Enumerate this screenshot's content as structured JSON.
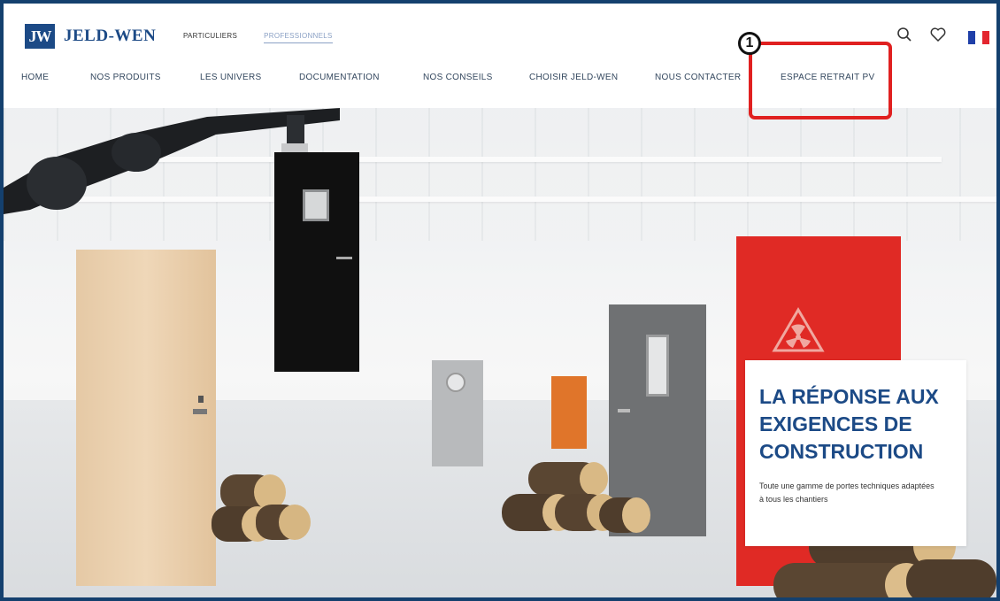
{
  "brand": {
    "logo_mark": "JW",
    "name": "JELD-WEN"
  },
  "audience": {
    "items": [
      "PARTICULIERS",
      "PROFESSIONNELS"
    ],
    "active": "PROFESSIONNELS"
  },
  "nav": {
    "items": [
      "HOME",
      "NOS PRODUITS",
      "LES UNIVERS",
      "DOCUMENTATION",
      "NOS CONSEILS",
      "CHOISIR JELD-WEN",
      "NOUS CONTACTER",
      "ESPACE RETRAIT PV"
    ]
  },
  "header_icons": [
    "search-icon",
    "heart-icon",
    "french-flag-icon"
  ],
  "annotation": {
    "badge": "1"
  },
  "hero": {
    "title_lines": [
      "LA RÉPONSE AUX",
      "EXIGENCES DE",
      "CONSTRUCTION"
    ],
    "subtitle": "Toute une gamme de portes techniques adaptées à tous les chantiers"
  },
  "colors": {
    "brand_blue": "#1c4a86",
    "annotation_red": "#e02020",
    "flag_blue": "#1f3fa8",
    "flag_red": "#e3262f"
  }
}
